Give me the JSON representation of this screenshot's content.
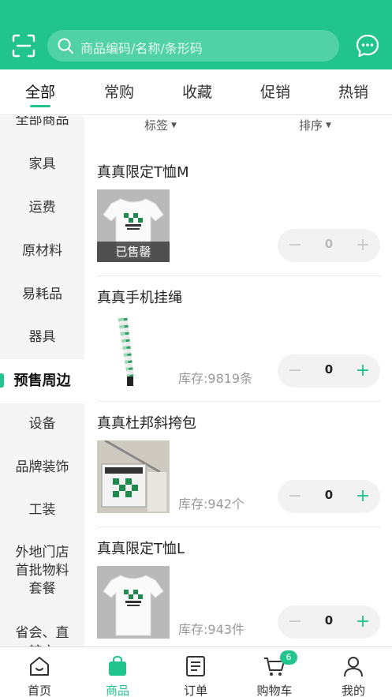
{
  "header": {
    "search_placeholder": "商品编码/名称/条形码",
    "scan_icon": "scan-icon",
    "message_icon": "chat-icon",
    "color": "#21c48d"
  },
  "tabs": [
    {
      "label": "全部",
      "active": true
    },
    {
      "label": "常购"
    },
    {
      "label": "收藏"
    },
    {
      "label": "促销"
    },
    {
      "label": "热销"
    }
  ],
  "filters": {
    "tag_label": "标签",
    "sort_label": "排序"
  },
  "sidebar": {
    "items": [
      {
        "label": "全部商品"
      },
      {
        "label": "家具"
      },
      {
        "label": "运费"
      },
      {
        "label": "原材料"
      },
      {
        "label": "易耗品"
      },
      {
        "label": "器具"
      },
      {
        "label": "预售周边",
        "active": true
      },
      {
        "label": "设备"
      },
      {
        "label": "品牌装饰"
      },
      {
        "label": "工装"
      },
      {
        "label": "外地门店首批物料套餐"
      },
      {
        "label": "省会、直辖市"
      }
    ]
  },
  "products": [
    {
      "name": "真真限定T恤M",
      "image": "t-shirt",
      "soldout_label": "已售罄",
      "stock": "",
      "quantity": "0",
      "minus": "−",
      "plus": "+"
    },
    {
      "name": "真真手机挂绳",
      "image": "phone-lanyard",
      "stock": "库存:9819条",
      "quantity": "0",
      "minus": "−",
      "plus": "+"
    },
    {
      "name": "真真杜邦斜挎包",
      "image": "crossbody-bag",
      "stock": "库存:942个",
      "quantity": "0",
      "minus": "−",
      "plus": "+"
    },
    {
      "name": "真真限定T恤L",
      "image": "t-shirt",
      "stock": "库存:943件",
      "quantity": "0",
      "minus": "−",
      "plus": "+"
    }
  ],
  "tabbar": {
    "items": [
      {
        "label": "首页",
        "icon": "home-icon"
      },
      {
        "label": "商品",
        "icon": "shopping-bag-icon",
        "active": true
      },
      {
        "label": "订单",
        "icon": "order-list-icon"
      },
      {
        "label": "购物车",
        "icon": "cart-icon",
        "badge": "6"
      },
      {
        "label": "我的",
        "icon": "user-icon"
      }
    ]
  }
}
